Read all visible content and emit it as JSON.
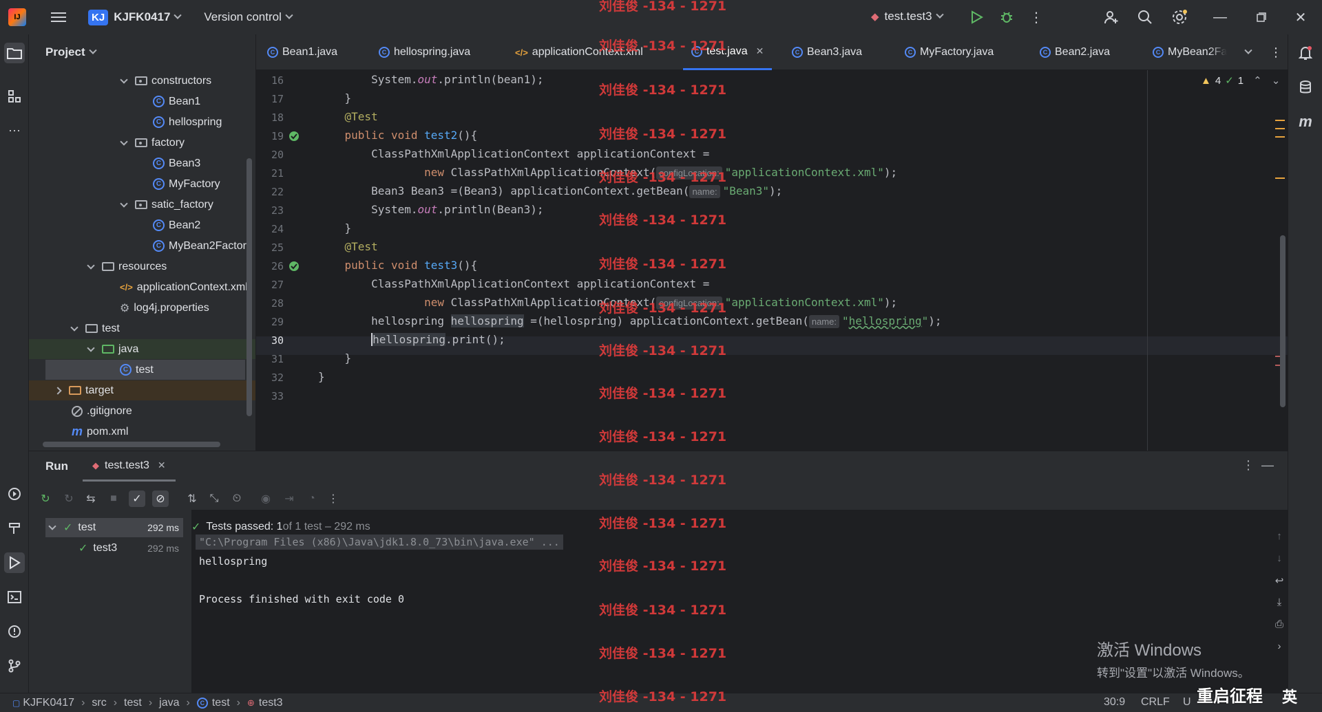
{
  "titlebar": {
    "app_logo": "IJ",
    "project_badge": "KJ",
    "project_name": "KJFK0417",
    "vcs_label": "Version control",
    "run_config": "test.test3",
    "icons": [
      "hamburger-menu-icon",
      "run-icon",
      "debug-icon",
      "more-icon",
      "add-user-icon",
      "search-icon",
      "settings-icon",
      "minimize-icon",
      "restore-icon",
      "close-icon"
    ]
  },
  "project_panel": {
    "title": "Project",
    "tree": [
      {
        "label": "constructors",
        "kind": "package"
      },
      {
        "label": "Bean1",
        "kind": "class"
      },
      {
        "label": "hellospring",
        "kind": "class"
      },
      {
        "label": "factory",
        "kind": "package"
      },
      {
        "label": "Bean3",
        "kind": "class"
      },
      {
        "label": "MyFactory",
        "kind": "class"
      },
      {
        "label": "satic_factory",
        "kind": "package"
      },
      {
        "label": "Bean2",
        "kind": "class"
      },
      {
        "label": "MyBean2Factory",
        "kind": "class"
      },
      {
        "label": "resources",
        "kind": "folder"
      },
      {
        "label": "applicationContext.xml",
        "kind": "xml"
      },
      {
        "label": "log4j.properties",
        "kind": "properties"
      },
      {
        "label": "test",
        "kind": "folder"
      },
      {
        "label": "java",
        "kind": "folder"
      },
      {
        "label": "test",
        "kind": "class"
      },
      {
        "label": "target",
        "kind": "folder"
      },
      {
        "label": ".gitignore",
        "kind": "ignore"
      },
      {
        "label": "pom.xml",
        "kind": "maven"
      }
    ]
  },
  "tabs": [
    {
      "label": "Bean1.java"
    },
    {
      "label": "hellospring.java"
    },
    {
      "label": "applicationContext.xml"
    },
    {
      "label": "test.java",
      "active": true
    },
    {
      "label": "Bean3.java"
    },
    {
      "label": "MyFactory.java"
    },
    {
      "label": "Bean2.java"
    },
    {
      "label": "MyBean2Fa"
    }
  ],
  "editor": {
    "line_numbers": [
      "16",
      "17",
      "18",
      "19",
      "20",
      "21",
      "22",
      "23",
      "24",
      "25",
      "26",
      "27",
      "28",
      "29",
      "30",
      "31",
      "32",
      "33"
    ],
    "current_line": "30",
    "inspections": {
      "warnings": "4",
      "ok": "1"
    },
    "code": {
      "l16_a": "        System.",
      "l16_out": "out",
      "l16_b": ".println(bean1);",
      "l17": "    }",
      "l18": "    @Test",
      "l19_kw": "    public void ",
      "l19_fn": "test2",
      "l19_b": "(){",
      "l20": "        ClassPathXmlApplicationContext applicationContext =",
      "l21_kw": "                new ",
      "l21_a": "ClassPathXmlApplicationContext(",
      "l21_hint": "configLocation:",
      "l21_str": "\"applicationContext.xml\"",
      "l21_b": ");",
      "l22_a": "        Bean3 Bean3 =(Bean3) applicationContext.getBean(",
      "l22_hint": "name:",
      "l22_str": "\"Bean3\"",
      "l22_b": ");",
      "l23_a": "        System.",
      "l23_out": "out",
      "l23_b": ".println(Bean3);",
      "l24": "    }",
      "l25": "    @Test",
      "l26_kw": "    public void ",
      "l26_fn": "test3",
      "l26_b": "(){",
      "l27": "        ClassPathXmlApplicationContext applicationContext =",
      "l28_kw": "                new ",
      "l28_a": "ClassPathXmlApplicationContext(",
      "l28_hint": "configLocation:",
      "l28_str": "\"applicationContext.xml\"",
      "l28_b": ");",
      "l29_a": "        hellospring ",
      "l29_hl": "hellospring",
      "l29_b": " =(hellospring) applicationContext.getBean(",
      "l29_hint": "name:",
      "l29_q1": "\"",
      "l29_und": "hellospring",
      "l29_q2": "\"",
      "l29_c": ");",
      "l30_pad": "        ",
      "l30_hl": "hellospring",
      "l30_b": ".print();",
      "l31": "    }",
      "l32": "}",
      "l33": ""
    }
  },
  "run_panel": {
    "title": "Run",
    "tab_label": "test.test3",
    "tests": [
      {
        "name": "test",
        "time": "292 ms"
      },
      {
        "name": "test3",
        "time": "292 ms"
      }
    ],
    "summary_bold": "Tests passed: 1",
    "summary_rest": " of 1 test – 292 ms",
    "console": {
      "cmd": "\"C:\\Program Files (x86)\\Java\\jdk1.8.0_73\\bin\\java.exe\" ...",
      "out1": "hellospring",
      "out2": "Process finished with exit code 0"
    }
  },
  "statusbar": {
    "crumbs": [
      "KJFK0417",
      "src",
      "test",
      "java",
      "test",
      "test3"
    ],
    "position": "30:9",
    "line_sep": "CRLF",
    "encoding": "U"
  },
  "watermark": {
    "text": "刘佳俊 -134 - 1271",
    "windows_line1": "激活 Windows",
    "windows_line2": "转到\"设置\"以激活 Windows。",
    "ime_text": "重启征程",
    "ime_lang": "英"
  },
  "colors": {
    "accent": "#3574f0",
    "pass": "#5fb865",
    "warning": "#f2c55c",
    "watermark": "#e03c3c"
  }
}
